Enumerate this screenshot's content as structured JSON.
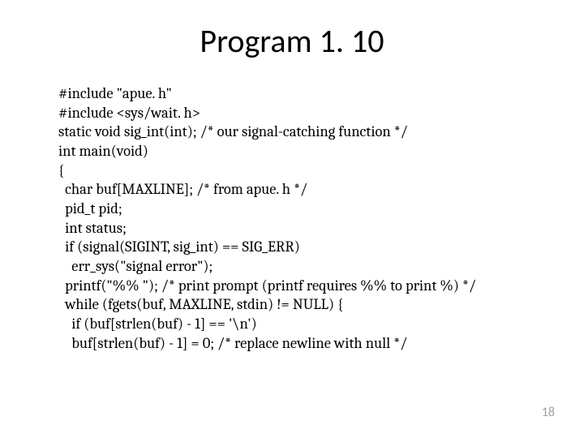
{
  "title": "Program 1. 10",
  "code": {
    "l1": "#include \"apue. h\"",
    "l2": "#include <sys/wait. h>",
    "l3": "static void sig_int(int); /* our signal-catching function */",
    "l4": "int main(void)",
    "l5": "{",
    "l6": "  char buf[MAXLINE]; /* from apue. h */",
    "l7": "  pid_t pid;",
    "l8": "  int status;",
    "l9": "  if (signal(SIGINT, sig_int) == SIG_ERR)",
    "l10": "    err_sys(\"signal error\");",
    "l11": "  printf(\"%% \"); /* print prompt (printf requires %% to print %) */",
    "l12": "  while (fgets(buf, MAXLINE, stdin) != NULL) {",
    "l13": "    if (buf[strlen(buf) - 1] == '\\n')",
    "l14": "    buf[strlen(buf) - 1] = 0; /* replace newline with null */"
  },
  "page_number": "18"
}
